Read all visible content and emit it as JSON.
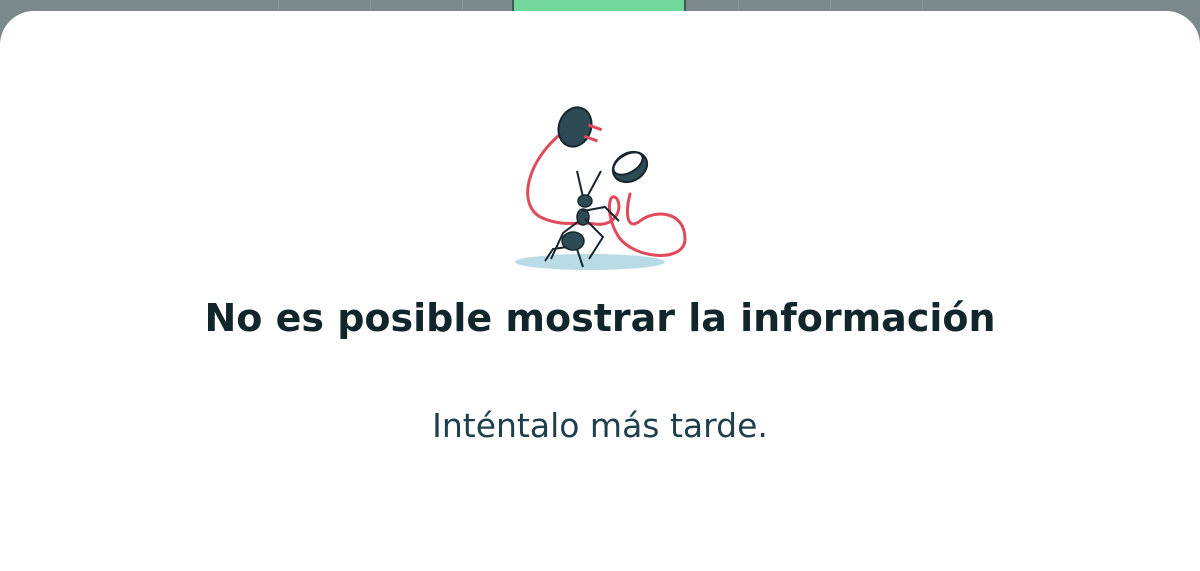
{
  "error_state": {
    "title": "No es posible mostrar la información",
    "message": "Inténtalo más tarde.",
    "illustration": "ant-unplugged-cable-illustration"
  },
  "colors": {
    "sheet_background": "#ffffff",
    "title_text": "#10262b",
    "message_text": "#1f3f4d",
    "handle_green": "#72d79a",
    "cable_red": "#e04a5a",
    "ant_body": "#2e4a55",
    "shadow_blue": "#b9dbe6"
  }
}
